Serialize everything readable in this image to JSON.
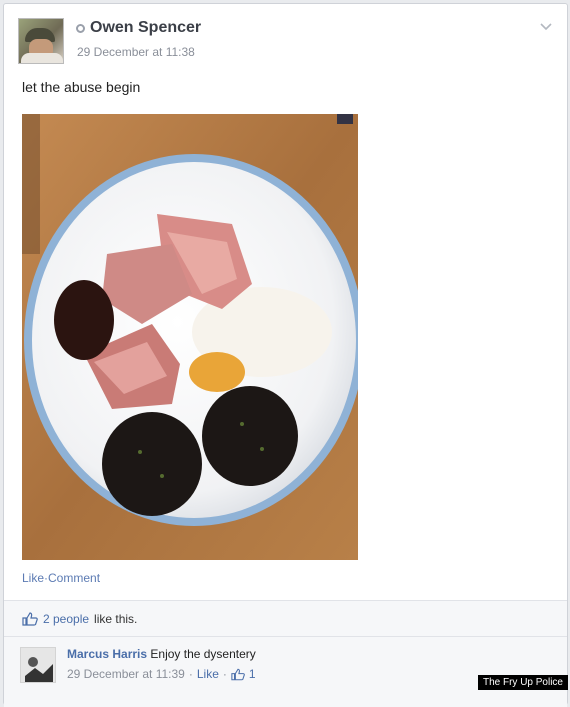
{
  "post": {
    "author": "Owen Spencer",
    "timestamp": "29 December at 11:38",
    "status_text": "let the abuse begin",
    "actions": {
      "like": "Like",
      "separator": " · ",
      "comment": "Comment"
    }
  },
  "likes": {
    "count_text": "2 people",
    "suffix": " like this."
  },
  "comment": {
    "author": "Marcus Harris",
    "text": "Enjoy the dysentery",
    "timestamp": "29 December at 11:39",
    "separator1": " · ",
    "like": "Like",
    "separator2": " · ",
    "like_count": "1"
  },
  "watermark": "The Fry Up Police",
  "icons": {
    "online": "online-status-icon",
    "chevron": "chevron-down-icon",
    "thumbs": "thumbs-up-icon"
  },
  "colors": {
    "link": "#4a6ea9",
    "muted": "#8a8f99",
    "panel": "#f6f7f9"
  }
}
